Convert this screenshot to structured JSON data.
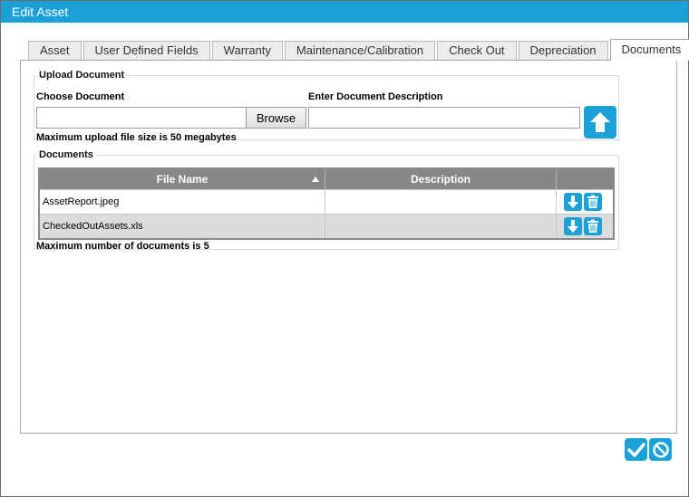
{
  "window": {
    "title": "Edit Asset"
  },
  "tabs": [
    {
      "label": "Asset"
    },
    {
      "label": "User Defined Fields"
    },
    {
      "label": "Warranty"
    },
    {
      "label": "Maintenance/Calibration"
    },
    {
      "label": "Check Out"
    },
    {
      "label": "Depreciation"
    },
    {
      "label": "Documents",
      "active": true
    }
  ],
  "upload": {
    "legend": "Upload Document",
    "choose_label": "Choose Document",
    "browse_label": "Browse",
    "choose_value": "",
    "description_label": "Enter Document Description",
    "description_value": "",
    "max_size_note": "Maximum upload file size is 50 megabytes"
  },
  "documents": {
    "legend": "Documents",
    "columns": {
      "file_name": "File Name",
      "description": "Description",
      "actions": ""
    },
    "sort": {
      "column": "file_name",
      "direction": "ascending"
    },
    "rows": [
      {
        "file_name": "AssetReport.jpeg",
        "description": ""
      },
      {
        "file_name": "CheckedOutAssets.xls",
        "description": ""
      }
    ],
    "max_docs_note": "Maximum number of documents is 5"
  },
  "theme": {
    "accent": "#1ba1d8",
    "header_bg": "#878787",
    "alt_row": "#dcdcdc"
  },
  "icons": {
    "upload": "arrow-up-icon",
    "download": "arrow-down-icon",
    "delete": "trash-icon",
    "save": "checkmark-icon",
    "cancel": "cancel-circle-icon"
  }
}
